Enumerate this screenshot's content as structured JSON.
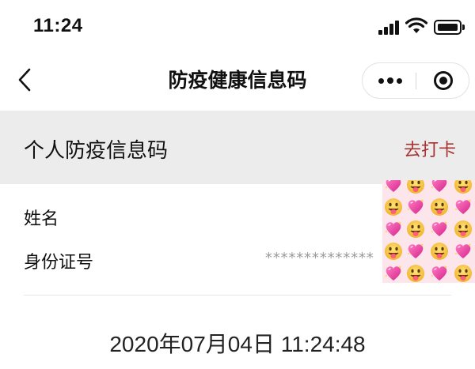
{
  "status_bar": {
    "time": "11:24",
    "icons": [
      "signal-icon",
      "wifi-icon",
      "battery-icon"
    ]
  },
  "nav": {
    "title": "防疫健康信息码",
    "back_icon": "chevron-left-icon",
    "more_icon": "more-dots-icon",
    "close_icon": "miniprogram-close-icon"
  },
  "section": {
    "title": "个人防疫信息码",
    "action": "去打卡",
    "action_color": "#a73432",
    "background": "#ececec"
  },
  "info": {
    "name_label": "姓名",
    "id_label": "身份证号",
    "id_value": "**************"
  },
  "sticker": {
    "description_icon": "emoji-sticker-icon"
  },
  "timestamp": "2020年07月04日 11:24:48"
}
